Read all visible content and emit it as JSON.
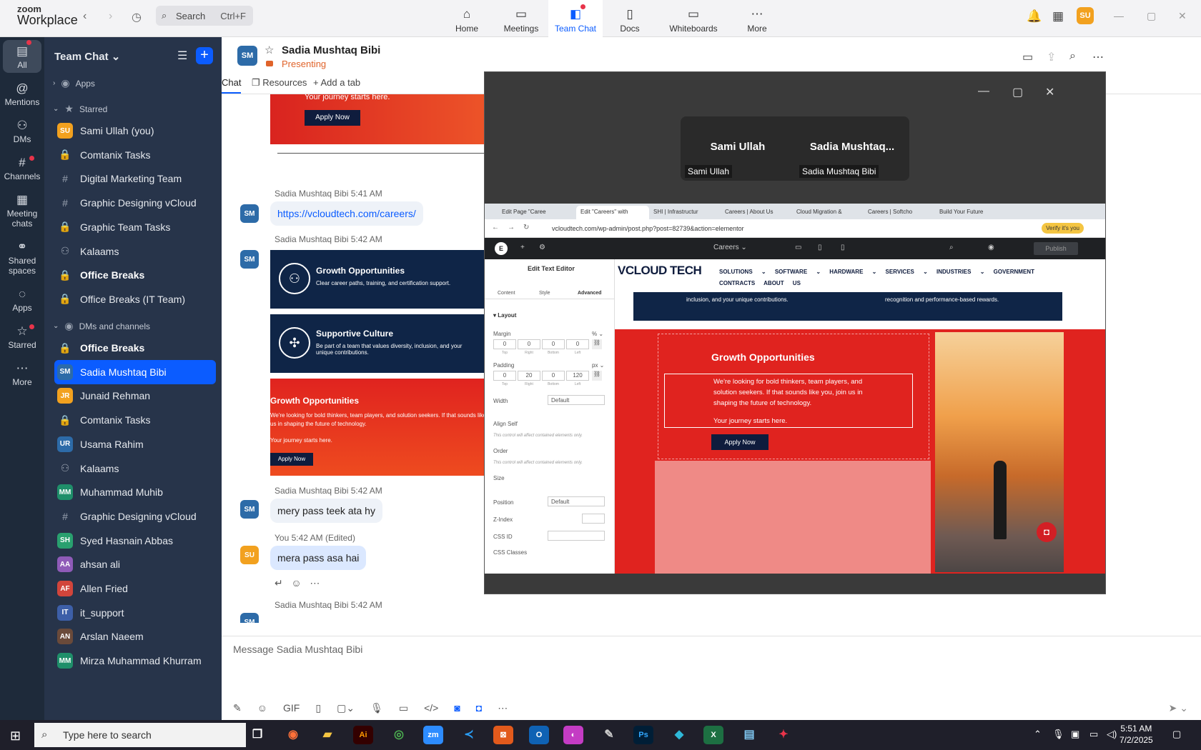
{
  "app": {
    "brand_top": "zoom",
    "brand_bottom": "Workplace"
  },
  "search": {
    "label": "Search",
    "shortcut": "Ctrl+F"
  },
  "top_tabs": [
    {
      "label": "Home",
      "icon": "home-icon"
    },
    {
      "label": "Meetings",
      "icon": "video-icon"
    },
    {
      "label": "Team Chat",
      "icon": "chat-icon"
    },
    {
      "label": "Docs",
      "icon": "doc-icon"
    },
    {
      "label": "Whiteboards",
      "icon": "whiteboard-icon"
    },
    {
      "label": "More",
      "icon": "more-icon"
    }
  ],
  "user_initials": "SU",
  "rail": [
    {
      "label": "All"
    },
    {
      "label": "Mentions"
    },
    {
      "label": "DMs"
    },
    {
      "label": "Channels"
    },
    {
      "label": "Meeting chats"
    },
    {
      "label": "Shared spaces"
    },
    {
      "label": "Apps"
    },
    {
      "label": "Starred"
    },
    {
      "label": "More"
    }
  ],
  "sidebar": {
    "title": "Team Chat",
    "apps_label": "Apps",
    "starred_label": "Starred",
    "dms_label": "DMs and channels",
    "starred": [
      {
        "name": "Sami Ullah (you)",
        "kind": "avatar",
        "initials": "SU",
        "color": "#f2a11f"
      },
      {
        "name": "Comtanix Tasks",
        "kind": "lock"
      },
      {
        "name": "Digital Marketing Team",
        "kind": "hash"
      },
      {
        "name": "Graphic Designing vCloud",
        "kind": "hash"
      },
      {
        "name": "Graphic Team Tasks",
        "kind": "lock"
      },
      {
        "name": "Kalaams",
        "kind": "group"
      },
      {
        "name": "Office Breaks",
        "kind": "lock"
      },
      {
        "name": "Office Breaks (IT Team)",
        "kind": "lock"
      }
    ],
    "dms": [
      {
        "name": "Office Breaks",
        "kind": "lock"
      },
      {
        "name": "Sadia Mushtaq Bibi",
        "kind": "avatar",
        "initials": "SM",
        "color": "#2d6ba8"
      },
      {
        "name": "Junaid Rehman",
        "kind": "avatar",
        "initials": "JR",
        "color": "#f2a11f"
      },
      {
        "name": "Comtanix Tasks",
        "kind": "lock"
      },
      {
        "name": "Usama Rahim",
        "kind": "avatar",
        "initials": "UR",
        "color": "#2d6ba8"
      },
      {
        "name": "Kalaams",
        "kind": "group"
      },
      {
        "name": "Muhammad Muhib",
        "kind": "avatar",
        "initials": "MM",
        "color": "#1f8f6a"
      },
      {
        "name": "Graphic Designing vCloud",
        "kind": "hash"
      },
      {
        "name": "Syed Hasnain Abbas",
        "kind": "avatar",
        "initials": "SH",
        "color": "#29a06f"
      },
      {
        "name": "ahsan ali",
        "kind": "avatar",
        "initials": "AA",
        "color": "#8f5bb8"
      },
      {
        "name": "Allen Fried",
        "kind": "avatar",
        "initials": "AF",
        "color": "#d2453b"
      },
      {
        "name": "it_support",
        "kind": "avatar",
        "initials": "IT",
        "color": "#3d5fa8"
      },
      {
        "name": "Arslan Naeem",
        "kind": "avatar",
        "initials": "AN",
        "color": "#6a4a3a"
      },
      {
        "name": "Mirza Muhammad Khurram",
        "kind": "avatar",
        "initials": "MM",
        "color": "#1f8f6a"
      }
    ]
  },
  "chat": {
    "contact_initials": "SM",
    "contact_name": "Sadia Mushtaq Bibi",
    "status": "Presenting",
    "tabs": [
      "Chat",
      "Resources",
      "Add a tab"
    ],
    "composer_placeholder": "Message Sadia Mushtaq Bibi",
    "messages": [
      {
        "author": "Sadia Mushtaq Bibi",
        "time": "5:41 AM",
        "text": "https://vcloudtech.com/careers/"
      },
      {
        "author": "Sadia Mushtaq Bibi",
        "time": "5:42 AM"
      },
      {
        "author": "Sadia Mushtaq Bibi",
        "time": "5:42 AM",
        "text": "mery pass teek ata hy"
      },
      {
        "author": "You",
        "time": "5:42 AM (Edited)",
        "text": "mera pass asa hai"
      },
      {
        "author": "Sadia Mushtaq Bibi",
        "time": "5:42 AM"
      }
    ],
    "cards": {
      "top_text": "Your journey starts here.",
      "top_button": "Apply Now",
      "growth_title": "Growth Opportunities",
      "growth_sub": "Clear career paths, training, and certification support.",
      "support_title": "Supportive Culture",
      "support_sub": "Be part of a team that values diversity, inclusion, and your unique contributions.",
      "red_title": "Growth Opportunities",
      "red_text": "We're looking for bold thinkers, team players, and solution seekers. If that sounds like you, join us in shaping the future of technology.",
      "red_journey": "Your journey starts here.",
      "red_button": "Apply Now"
    }
  },
  "share": {
    "tiles": [
      {
        "name": "Sami Ullah",
        "label": "Sami Ullah"
      },
      {
        "name": "Sadia  Mushtaq...",
        "label": "Sadia Mushtaq Bibi"
      }
    ],
    "browser": {
      "tabs": [
        "Edit Page \"Caree",
        "Edit \"Careers\" with",
        "SHI | Infrastructur",
        "Careers | About Us",
        "Cloud Migration &",
        "Careers | Softcho",
        "Build Your Future"
      ],
      "url": "vcloudtech.com/wp-admin/post.php?post=82739&action=elementor",
      "verify": "Verify it's you",
      "page_select": "Careers",
      "publish": "Publish",
      "panel_title": "Edit Text Editor",
      "panel_tabs": [
        "Content",
        "Style",
        "Advanced"
      ],
      "layout": "Layout",
      "margin": "Margin",
      "margin_vals": [
        "0",
        "0",
        "0",
        "0"
      ],
      "margin_caps": [
        "Top",
        "Right",
        "Bottom",
        "Left"
      ],
      "padding": "Padding",
      "padding_vals": [
        "0",
        "20",
        "0",
        "120"
      ],
      "unit_pct": "% ⌄",
      "unit_px": "px ⌄",
      "width": "Width",
      "width_val": "Default",
      "align_self": "Align Self",
      "note": "This control will affect contained elements only.",
      "order": "Order",
      "size": "Size",
      "position": "Position",
      "position_val": "Default",
      "zindex": "Z-Index",
      "css_id": "CSS ID",
      "css_classes": "CSS Classes",
      "site_logo": "VCLOUD TECH",
      "menu": "SOLUTIONS ⌄ SOFTWARE ⌄ HARDWARE ⌄ SERVICES ⌄ INDUSTRIES ⌄ GOVERNMENT CONTRACTS ABOUT US",
      "strip_left": "inclusion, and your unique contributions.",
      "strip_right": "recognition and performance-based rewards.",
      "growth": "Growth Opportunities",
      "growth_text": "We're looking for bold thinkers, team players, and solution seekers. If that sounds like you, join us in shaping the future of technology.",
      "journey": "Your journey starts here.",
      "apply": "Apply Now"
    }
  },
  "taskbar": {
    "search_placeholder": "Type here to search",
    "time": "5:51 AM",
    "date": "7/2/2025"
  }
}
